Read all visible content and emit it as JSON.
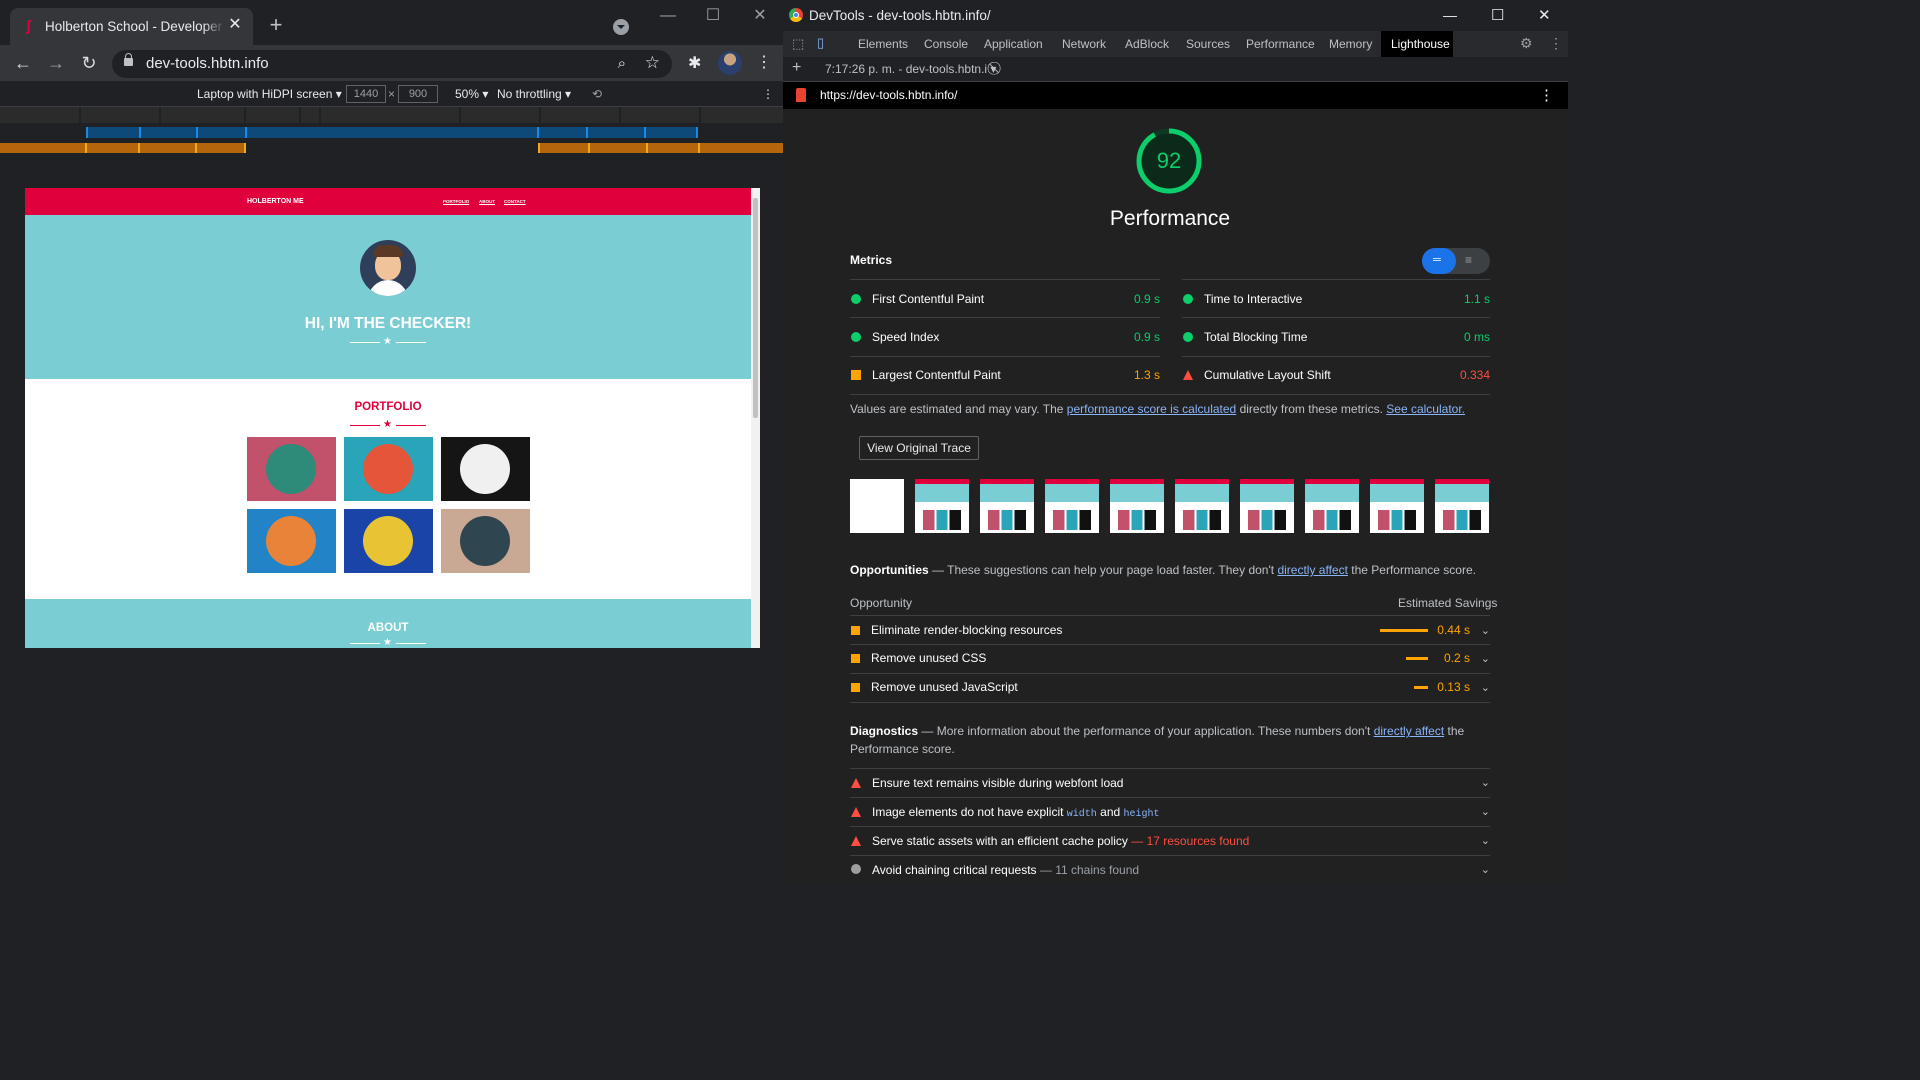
{
  "browser": {
    "tab_title": "Holberton School - Developer tools",
    "url": "dev-tools.hbtn.info",
    "device_name": "Laptop with HiDPI screen",
    "width": "1440",
    "height": "900",
    "times": "×",
    "zoom": "50%",
    "throttling": "No throttling"
  },
  "site": {
    "brand": "HOLBERTON ME",
    "nav": [
      "PORTFOLIO",
      "ABOUT",
      "CONTACT"
    ],
    "hero_title": "HI, I'M THE CHECKER!",
    "portfolio_title": "PORTFOLIO",
    "about_title": "ABOUT",
    "thumb_colors": [
      "#c2516b",
      "#2aa4b8",
      "#151515",
      "#2283c6",
      "#1a44a8",
      "#c9a894"
    ]
  },
  "devtools": {
    "window_title": "DevTools - dev-tools.hbtn.info/",
    "tabs": [
      "Elements",
      "Console",
      "Application",
      "Network",
      "AdBlock",
      "Sources",
      "Performance",
      "Memory",
      "Lighthouse"
    ],
    "active_tab": "Lighthouse",
    "report_select": "7:17:26 p. m. - dev-tools.hbtn.i",
    "report_url": "https://dev-tools.hbtn.info/"
  },
  "lighthouse": {
    "score": "92",
    "score_fraction": 0.92,
    "category": "Performance",
    "metrics_heading": "Metrics",
    "metrics": [
      {
        "label": "First Contentful Paint",
        "value": "0.9 s",
        "status": "pass"
      },
      {
        "label": "Time to Interactive",
        "value": "1.1 s",
        "status": "pass"
      },
      {
        "label": "Speed Index",
        "value": "0.9 s",
        "status": "pass"
      },
      {
        "label": "Total Blocking Time",
        "value": "0 ms",
        "status": "pass"
      },
      {
        "label": "Largest Contentful Paint",
        "value": "1.3 s",
        "status": "average"
      },
      {
        "label": "Cumulative Layout Shift",
        "value": "0.334",
        "status": "fail"
      }
    ],
    "disclaimer_pre": "Values are estimated and may vary. The",
    "disclaimer_link1": "performance score is calculated",
    "disclaimer_mid": "directly from these metrics.",
    "disclaimer_link2": "See calculator.",
    "view_trace": "View Original Trace",
    "opportunities_heading": "Opportunities",
    "opportunities_desc_pre": "— These suggestions can help your page load faster. They don't",
    "opportunities_desc_link": "directly affect",
    "opportunities_desc_post": "the Performance score.",
    "opp_col_left": "Opportunity",
    "opp_col_right": "Estimated Savings",
    "opportunities": [
      {
        "label": "Eliminate render-blocking resources",
        "value": "0.44 s",
        "fraction": 1.0
      },
      {
        "label": "Remove unused CSS",
        "value": "0.2 s",
        "fraction": 0.45
      },
      {
        "label": "Remove unused JavaScript",
        "value": "0.13 s",
        "fraction": 0.3
      }
    ],
    "diagnostics_heading": "Diagnostics",
    "diagnostics_desc_pre": "— More information about the performance of your application. These numbers don't",
    "diagnostics_desc_link": "directly affect",
    "diagnostics_desc_post": "the",
    "diagnostics_desc_line2": "Performance score.",
    "diagnostics": [
      {
        "label": "Ensure text remains visible during webfont load"
      },
      {
        "label_pre": "Image elements do not have explicit",
        "code1": "width",
        "and": "and",
        "code2": "height"
      },
      {
        "label": "Serve static assets with an efficient cache policy",
        "extra": "— 17 resources found"
      },
      {
        "label": "Avoid chaining critical requests",
        "extra": "— 11 chains found"
      }
    ],
    "colors": {
      "pass": "#0cce6b",
      "average": "#ffa400",
      "fail": "#ff4e42",
      "link": "#8ab4f8"
    }
  }
}
